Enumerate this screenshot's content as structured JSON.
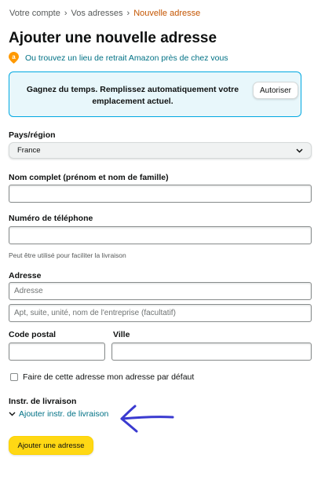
{
  "breadcrumb": {
    "item1": "Votre compte",
    "item2": "Vos adresses",
    "current": "Nouvelle adresse",
    "separator": "›"
  },
  "page": {
    "title": "Ajouter une nouvelle adresse",
    "pickup_link": "Ou trouvez un lieu de retrait Amazon près de chez vous",
    "pickup_icon_letter": "a"
  },
  "banner": {
    "message": "Gagnez du temps. Remplissez automatiquement votre emplacement actuel.",
    "button": "Autoriser"
  },
  "form": {
    "country_label": "Pays/région",
    "country_value": "France",
    "name_label": "Nom complet (prénom et nom de famille)",
    "name_value": "",
    "phone_label": "Numéro de téléphone",
    "phone_value": "",
    "phone_hint": "Peut être utilisé pour faciliter la livraison",
    "address_label": "Adresse",
    "address_placeholder": "Adresse",
    "address2_placeholder": "Apt, suite, unité, nom de l'entreprise (facultatif)",
    "postal_label": "Code postal",
    "postal_value": "",
    "city_label": "Ville",
    "city_value": "",
    "default_checkbox_label": "Faire de cette adresse mon adresse par défaut",
    "default_checked": false,
    "delivery_label": "Instr. de livraison",
    "delivery_toggle": "Ajouter instr. de livraison",
    "submit": "Ajouter une adresse"
  },
  "colors": {
    "link": "#007185",
    "breadcrumb_current": "#c45500",
    "banner_bg": "#e8f7fb",
    "banner_border": "#00a8e1",
    "submit_bg": "#ffd814",
    "pin": "#ff9900",
    "annotation_arrow": "#3a3ad0"
  }
}
